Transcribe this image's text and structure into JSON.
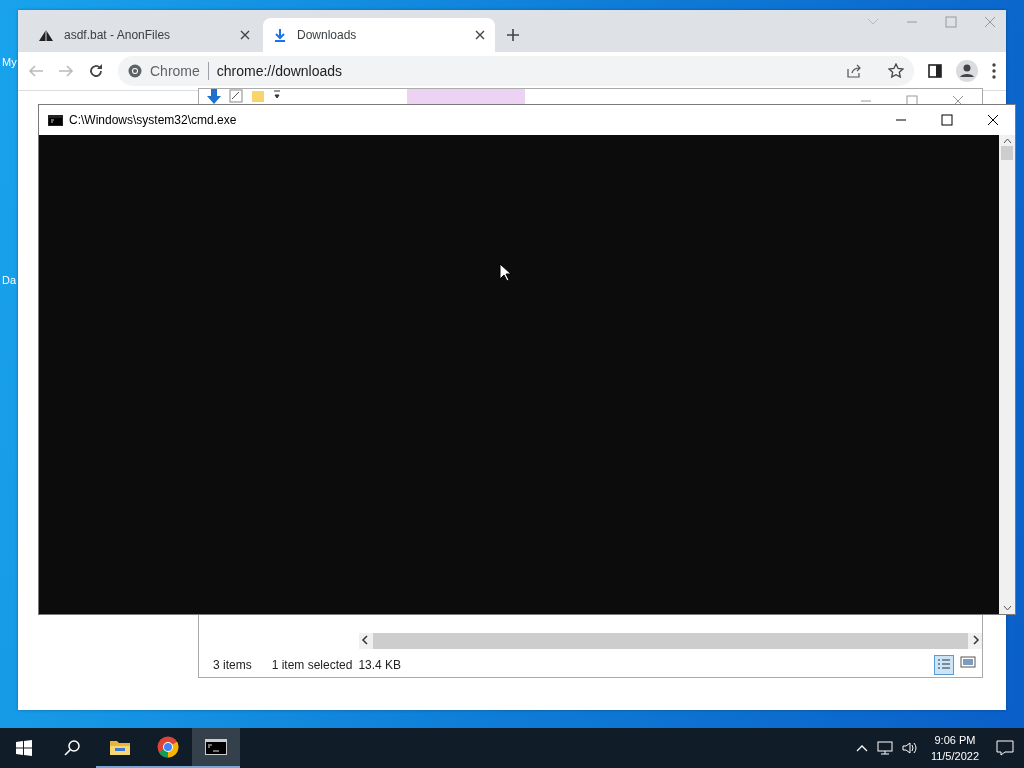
{
  "desktop": {
    "icons": [
      {
        "label": "My"
      },
      {
        "label": "Da"
      }
    ]
  },
  "browser": {
    "tabs": [
      {
        "title": "asdf.bat - AnonFiles",
        "kind": "site",
        "selected": false
      },
      {
        "title": "Downloads",
        "kind": "downloads",
        "selected": true
      }
    ],
    "address": {
      "site_chip": "Chrome",
      "url": "chrome://downloads"
    }
  },
  "explorer": {
    "status_bar": {
      "item_count": "3 items",
      "selection": "1 item selected",
      "size": "13.4 KB"
    }
  },
  "console": {
    "title": "C:\\Windows\\system32\\cmd.exe"
  },
  "taskbar": {
    "apps": [
      {
        "kind": "folder",
        "selected": false
      },
      {
        "kind": "chrome",
        "selected": false
      },
      {
        "kind": "console",
        "selected": true
      }
    ],
    "clock": {
      "time": "9:06 PM",
      "date": "11/5/2022"
    }
  }
}
